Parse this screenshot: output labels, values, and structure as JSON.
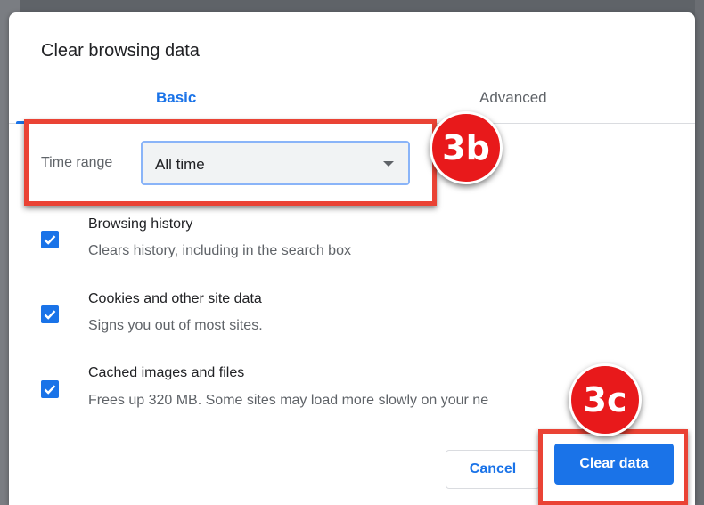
{
  "dialog": {
    "title": "Clear browsing data",
    "tabs": [
      {
        "label": "Basic",
        "active": true
      },
      {
        "label": "Advanced",
        "active": false
      }
    ],
    "time_range": {
      "label": "Time range",
      "value": "All time"
    },
    "items": [
      {
        "title": "Browsing history",
        "description": "Clears history, including in the search box",
        "checked": true
      },
      {
        "title": "Cookies and other site data",
        "description": "Signs you out of most sites.",
        "checked": true
      },
      {
        "title": "Cached images and files",
        "description": "Frees up 320 MB. Some sites may load more slowly on your ne",
        "checked": true
      }
    ],
    "buttons": {
      "cancel": "Cancel",
      "clear": "Clear data"
    }
  },
  "annotations": {
    "step_3b": "3b",
    "step_3c": "3c",
    "highlight_color": "#ea4335",
    "badge_color": "#e8191b"
  },
  "colors": {
    "accent": "#1a73e8"
  }
}
